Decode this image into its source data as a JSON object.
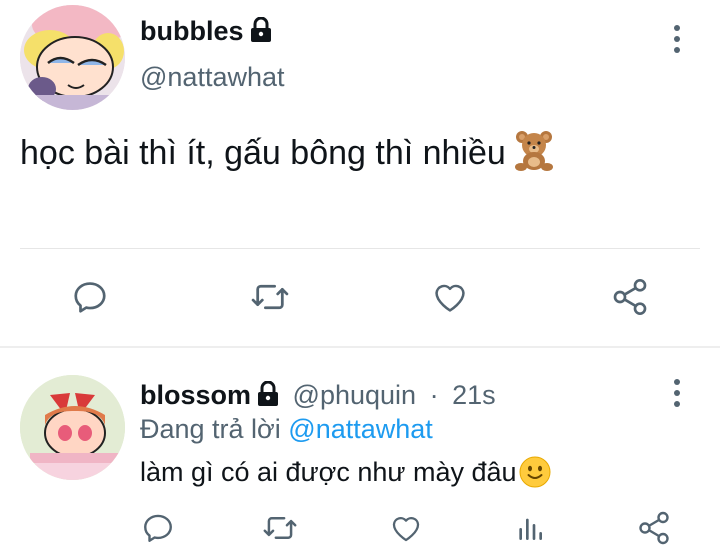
{
  "main_tweet": {
    "display_name": "bubbles",
    "handle": "@nattawhat",
    "text": "học bài thì ít, gấu bông thì nhiều",
    "avatar_icon": "bubbles-avatar",
    "emoji_icon": "teddy-bear-icon",
    "actions": [
      "reply-icon",
      "retweet-icon",
      "like-icon",
      "share-icon"
    ]
  },
  "reply_tweet": {
    "display_name": "blossom",
    "handle": "@phuquin",
    "separator": "·",
    "time": "21s",
    "replying_prefix": "Đang trả lời",
    "replying_to": "@nattawhat",
    "text": "làm gì có ai được như mày đâu",
    "avatar_icon": "blossom-avatar",
    "emoji_icon": "slightly-smiling-face-icon",
    "actions": [
      "reply-icon",
      "retweet-icon",
      "like-icon",
      "analytics-icon",
      "share-icon"
    ]
  },
  "colors": {
    "text": "#0f1419",
    "secondary": "#536471",
    "accent": "#1d9bf0",
    "divider": "#e6e6e6"
  }
}
